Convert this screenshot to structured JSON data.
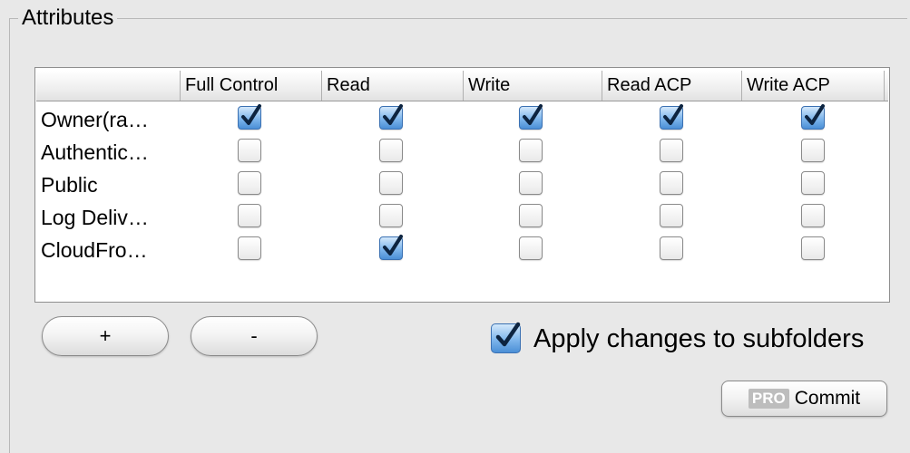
{
  "group": {
    "title": "Attributes"
  },
  "table": {
    "columns": [
      "",
      "Full Control",
      "Read",
      "Write",
      "Read ACP",
      "Write ACP"
    ],
    "rows": [
      {
        "label": "Owner(ra…",
        "checks": [
          true,
          true,
          true,
          true,
          true
        ]
      },
      {
        "label": "Authentic…",
        "checks": [
          false,
          false,
          false,
          false,
          false
        ]
      },
      {
        "label": "Public",
        "checks": [
          false,
          false,
          false,
          false,
          false
        ]
      },
      {
        "label": "Log Deliv…",
        "checks": [
          false,
          false,
          false,
          false,
          false
        ]
      },
      {
        "label": "CloudFro…",
        "checks": [
          false,
          true,
          false,
          false,
          false
        ]
      }
    ]
  },
  "buttons": {
    "add_label": "+",
    "remove_label": "-"
  },
  "apply": {
    "label": "Apply changes to subfolders",
    "checked": true
  },
  "commit": {
    "badge": "PRO",
    "label": "Commit"
  }
}
